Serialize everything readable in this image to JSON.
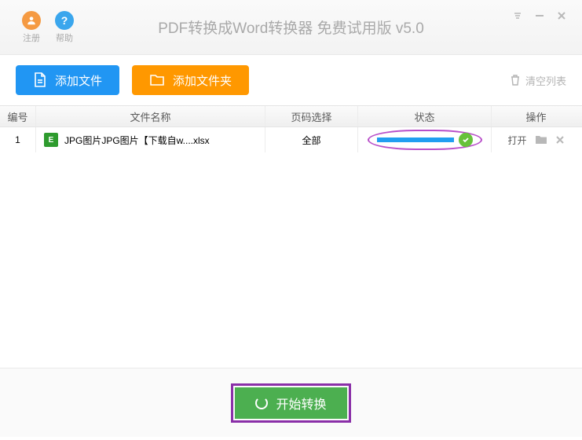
{
  "header": {
    "register_label": "注册",
    "help_label": "帮助",
    "title": "PDF转换成Word转换器 免费试用版 v5.0"
  },
  "toolbar": {
    "add_file_label": "添加文件",
    "add_folder_label": "添加文件夹",
    "clear_list_label": "清空列表"
  },
  "columns": {
    "num": "编号",
    "name": "文件名称",
    "pages": "页码选择",
    "status": "状态",
    "ops": "操作"
  },
  "rows": [
    {
      "num": "1",
      "file_badge": "E",
      "filename": "JPG图片JPG图片【下载自w....xlsx",
      "pages": "全部",
      "open_label": "打开"
    }
  ],
  "footer": {
    "start_label": "开始转换"
  }
}
